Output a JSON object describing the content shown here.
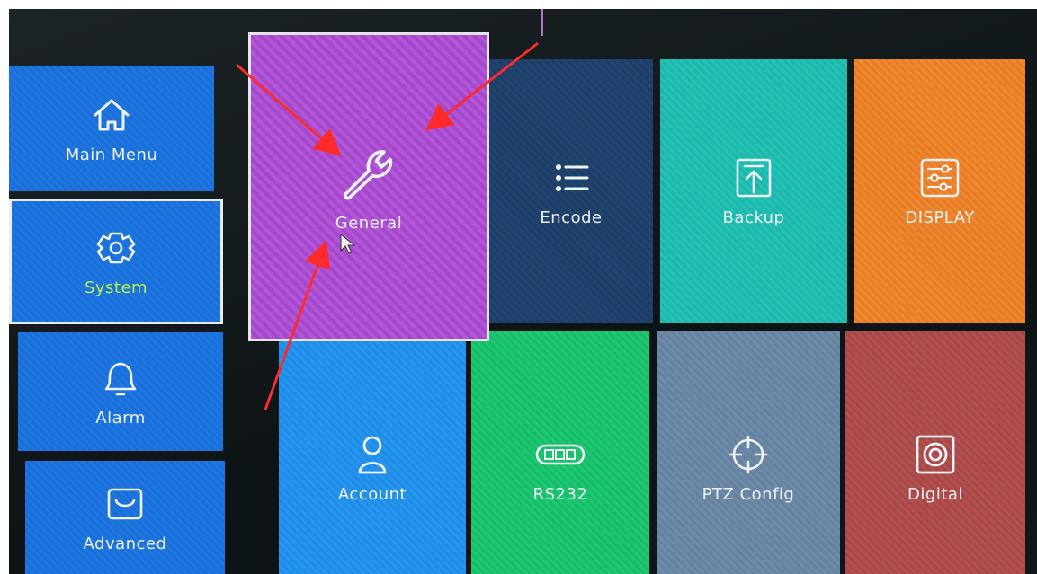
{
  "sidebar": {
    "items": [
      {
        "label": "Main Menu",
        "icon": "home-icon"
      },
      {
        "label": "System",
        "icon": "gear-icon",
        "selected": true
      },
      {
        "label": "Alarm",
        "icon": "bell-icon"
      },
      {
        "label": "Advanced",
        "icon": "bag-icon"
      }
    ]
  },
  "tiles": {
    "general": {
      "label": "General",
      "icon": "wrench-icon",
      "color": "#b455d8"
    },
    "encode": {
      "label": "Encode",
      "icon": "list-icon",
      "color": "#21446f"
    },
    "backup": {
      "label": "Backup",
      "icon": "upload-icon",
      "color": "#22c1b6"
    },
    "display": {
      "label": "DISPLAY",
      "icon": "sliders-icon",
      "color": "#f0862e"
    },
    "account": {
      "label": "Account",
      "icon": "user-icon",
      "color": "#2695f0"
    },
    "rs232": {
      "label": "RS232",
      "icon": "serial-port-icon",
      "color": "#1ec872"
    },
    "ptz": {
      "label": "PTZ Config",
      "icon": "crosshair-icon",
      "color": "#6e8aa9"
    },
    "digital": {
      "label": "Digital",
      "icon": "speaker-icon",
      "color": "#b24f4f"
    }
  },
  "colors": {
    "selected_label": "#b6f24a",
    "annotation_arrow": "#ff2a2a"
  }
}
